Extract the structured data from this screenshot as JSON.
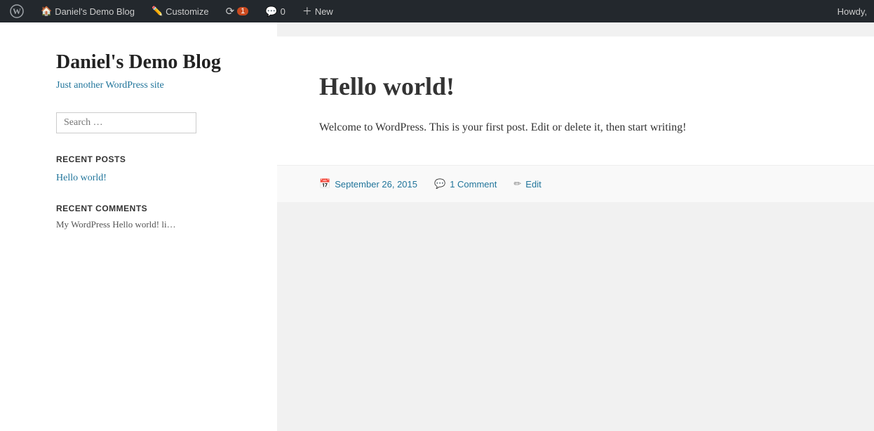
{
  "adminBar": {
    "wpLogo": "W",
    "siteName": "Daniel's Demo Blog",
    "customize": "Customize",
    "updates": "1",
    "comments": "0",
    "new": "New",
    "howdy": "Howdy,"
  },
  "sidebar": {
    "siteTitle": "Daniel's Demo Blog",
    "tagline": "Just another WordPress site",
    "searchPlaceholder": "Search …",
    "recentPostsLabel": "Recent Posts",
    "recentPosts": [
      {
        "title": "Hello world!"
      }
    ],
    "recentCommentsLabel": "Recent Comments",
    "commentSnippet": "My WordPress Hello world! li…"
  },
  "post": {
    "title": "Hello world!",
    "content": "Welcome to WordPress. This is your first post. Edit or delete it, then start writing!",
    "date": "September 26, 2015",
    "comments": "1 Comment",
    "editLabel": "Edit"
  }
}
